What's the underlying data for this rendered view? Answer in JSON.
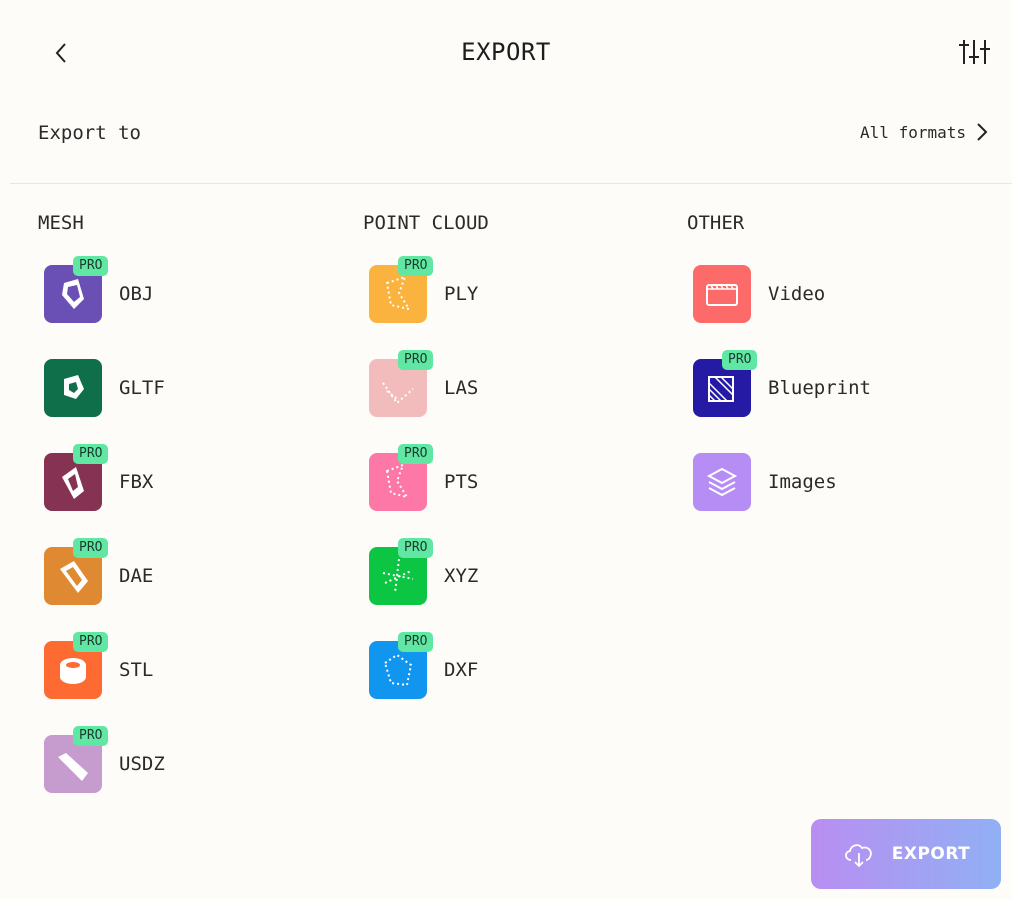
{
  "header": {
    "title": "EXPORT",
    "back_icon": "chevron-left-icon",
    "settings_icon": "sliders-icon"
  },
  "export_to": {
    "label": "Export to",
    "all_formats_label": "All formats"
  },
  "pro_badge": "PRO",
  "columns": [
    {
      "title": "MESH",
      "items": [
        {
          "label": "OBJ",
          "color": "#6a4fb5",
          "pro": true
        },
        {
          "label": "GLTF",
          "color": "#0f6f4a",
          "pro": false
        },
        {
          "label": "FBX",
          "color": "#863252",
          "pro": true
        },
        {
          "label": "DAE",
          "color": "#df8a32",
          "pro": true
        },
        {
          "label": "STL",
          "color": "#fd6a32",
          "pro": true
        },
        {
          "label": "USDZ",
          "color": "#c69ccf",
          "pro": true
        }
      ]
    },
    {
      "title": "POINT CLOUD",
      "items": [
        {
          "label": "PLY",
          "color": "#fbb33f",
          "pro": true
        },
        {
          "label": "LAS",
          "color": "#f3bcbc",
          "pro": true
        },
        {
          "label": "PTS",
          "color": "#fd78a6",
          "pro": true
        },
        {
          "label": "XYZ",
          "color": "#0cc543",
          "pro": true
        },
        {
          "label": "DXF",
          "color": "#1196ef",
          "pro": true
        }
      ]
    },
    {
      "title": "OTHER",
      "items": [
        {
          "label": "Video",
          "color": "#fd6a6a",
          "pro": false
        },
        {
          "label": "Blueprint",
          "color": "#241aa3",
          "pro": true
        },
        {
          "label": "Images",
          "color": "#b68cf5",
          "pro": false
        }
      ]
    }
  ],
  "export_button": {
    "label": "EXPORT",
    "icon": "cloud-download-icon",
    "gradient_start": "#b98ef1",
    "gradient_end": "#90b0f4"
  }
}
